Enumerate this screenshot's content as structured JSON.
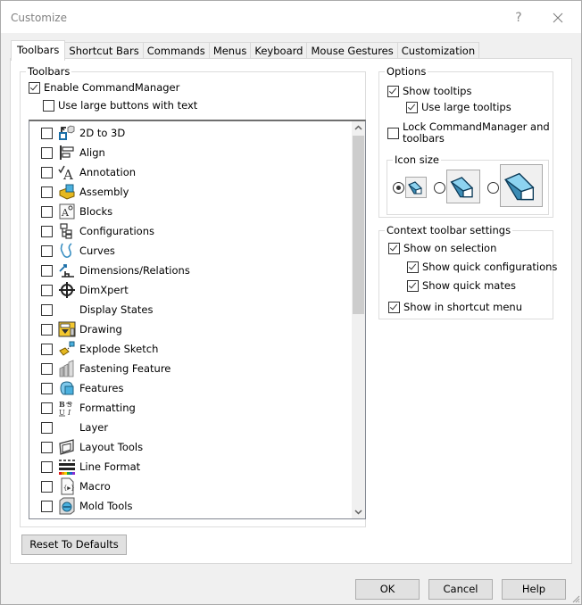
{
  "window": {
    "title": "Customize",
    "help_label": "?",
    "close_icon": "close-icon"
  },
  "tabs": [
    {
      "label": "Toolbars",
      "active": true
    },
    {
      "label": "Shortcut Bars",
      "active": false
    },
    {
      "label": "Commands",
      "active": false
    },
    {
      "label": "Menus",
      "active": false
    },
    {
      "label": "Keyboard",
      "active": false
    },
    {
      "label": "Mouse Gestures",
      "active": false
    },
    {
      "label": "Customization",
      "active": false
    }
  ],
  "toolbars_group": {
    "label": "Toolbars",
    "enable_commandmanager": {
      "label": "Enable CommandManager",
      "checked": true
    },
    "large_buttons": {
      "label": "Use large buttons with text",
      "checked": false
    },
    "items": [
      {
        "label": "2D to 3D",
        "icon": "2d-to-3d-icon",
        "checked": false
      },
      {
        "label": "Align",
        "icon": "align-icon",
        "checked": false
      },
      {
        "label": "Annotation",
        "icon": "annotation-icon",
        "checked": false
      },
      {
        "label": "Assembly",
        "icon": "assembly-icon",
        "checked": false
      },
      {
        "label": "Blocks",
        "icon": "blocks-icon",
        "checked": false
      },
      {
        "label": "Configurations",
        "icon": "configurations-icon",
        "checked": false
      },
      {
        "label": "Curves",
        "icon": "curves-icon",
        "checked": false
      },
      {
        "label": "Dimensions/Relations",
        "icon": "dimensions-relations-icon",
        "checked": false
      },
      {
        "label": "DimXpert",
        "icon": "dimxpert-icon",
        "checked": false
      },
      {
        "label": "Display States",
        "icon": "",
        "checked": false
      },
      {
        "label": "Drawing",
        "icon": "drawing-icon",
        "checked": false
      },
      {
        "label": "Explode Sketch",
        "icon": "explode-sketch-icon",
        "checked": false
      },
      {
        "label": "Fastening Feature",
        "icon": "fastening-feature-icon",
        "checked": false
      },
      {
        "label": "Features",
        "icon": "features-icon",
        "checked": false
      },
      {
        "label": "Formatting",
        "icon": "formatting-icon",
        "checked": false
      },
      {
        "label": "Layer",
        "icon": "",
        "checked": false
      },
      {
        "label": "Layout Tools",
        "icon": "layout-tools-icon",
        "checked": false
      },
      {
        "label": "Line Format",
        "icon": "line-format-icon",
        "checked": false
      },
      {
        "label": "Macro",
        "icon": "macro-icon",
        "checked": false
      },
      {
        "label": "Mold Tools",
        "icon": "mold-tools-icon",
        "checked": false
      }
    ]
  },
  "options_group": {
    "label": "Options",
    "show_tooltips": {
      "label": "Show tooltips",
      "checked": true
    },
    "large_tooltips": {
      "label": "Use large tooltips",
      "checked": true
    },
    "lock_line1": "Lock CommandManager and",
    "lock_line2": "toolbars",
    "lock_checked": false,
    "icon_size": {
      "label": "Icon size",
      "options": [
        {
          "size": "small",
          "selected": true
        },
        {
          "size": "medium",
          "selected": false
        },
        {
          "size": "large",
          "selected": false
        }
      ]
    }
  },
  "context_group": {
    "label": "Context toolbar settings",
    "show_on_selection": {
      "label": "Show on selection",
      "checked": true
    },
    "quick_configurations": {
      "label": "Show quick configurations",
      "checked": true
    },
    "quick_mates": {
      "label": "Show quick mates",
      "checked": true
    },
    "shortcut_menu": {
      "label": "Show in shortcut menu",
      "checked": true
    }
  },
  "buttons": {
    "reset": "Reset To Defaults",
    "ok": "OK",
    "cancel": "Cancel",
    "help": "Help"
  }
}
